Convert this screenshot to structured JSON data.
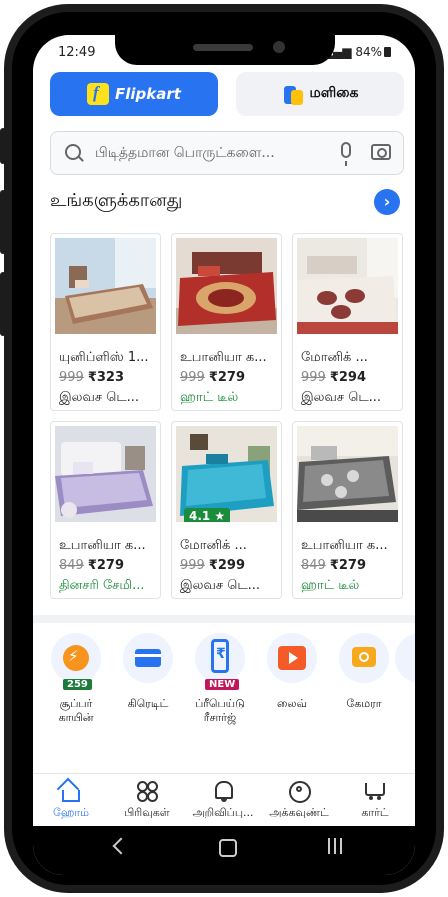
{
  "status_bar": {
    "time": "12:49",
    "battery": "84%"
  },
  "tabs": {
    "flipkart": "Flipkart",
    "grocery": "மளிகை"
  },
  "search": {
    "placeholder": "பிடித்தமான பொருட்களை..."
  },
  "section": {
    "title": "உங்களுக்கானது"
  },
  "products": [
    {
      "name": "யுனிப்ளிஸ் 1...",
      "old_price": "999",
      "price": "₹323",
      "tag": "இலவச டெ..."
    },
    {
      "name": "உபானியா க...",
      "old_price": "999",
      "price": "₹279",
      "tag": "ஹாட் டீல்"
    },
    {
      "name": "மோனிக் ...",
      "old_price": "999",
      "price": "₹294",
      "tag": "இலவச டெ..."
    },
    {
      "name": "உபானியா க...",
      "old_price": "849",
      "price": "₹279",
      "tag": "தினசரி சேமி..."
    },
    {
      "name": "மோனிக் ...",
      "old_price": "999",
      "price": "₹299",
      "tag": "இலவச டெ...",
      "rating": "4.1 ★"
    },
    {
      "name": "உபானியா க...",
      "old_price": "849",
      "price": "₹279",
      "tag": "ஹாட் டீல்"
    }
  ],
  "quick_links": [
    {
      "label": "சூப்பர் காயின்",
      "badge": "259",
      "icon": "supercoin-icon"
    },
    {
      "label": "கிரெடிட்",
      "icon": "credit-card-icon"
    },
    {
      "label": "ப்ரீபெய்டு ரீசார்ஜ்",
      "badge": "NEW",
      "icon": "recharge-icon"
    },
    {
      "label": "லைவ்",
      "icon": "play-icon"
    },
    {
      "label": "கேமரா",
      "icon": "camera-icon"
    }
  ],
  "bottom_nav": [
    {
      "label": "ஹோம்",
      "icon": "home-icon",
      "active": true
    },
    {
      "label": "பிரிவுகள்",
      "icon": "categories-icon"
    },
    {
      "label": "அறிவிப்பு...",
      "icon": "bell-icon"
    },
    {
      "label": "அக்கவுண்ட்",
      "icon": "account-icon"
    },
    {
      "label": "கார்ட்",
      "icon": "cart-icon"
    }
  ],
  "colors": {
    "brand": "#2873f0",
    "deal_green": "#1a8c3b",
    "badge_green": "#1e7c3b",
    "badge_red": "#c2185b"
  }
}
